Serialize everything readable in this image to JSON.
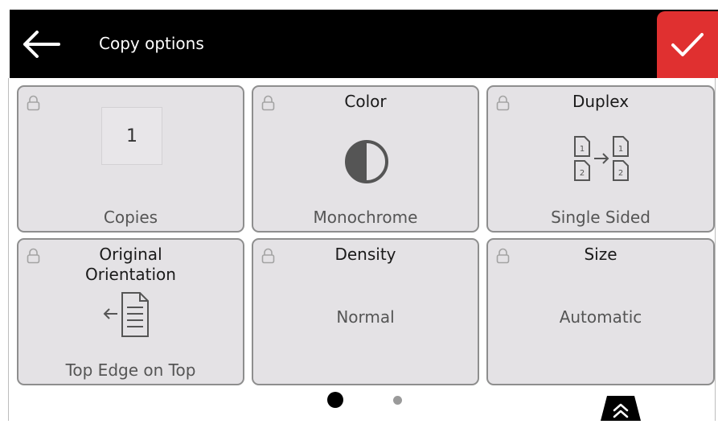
{
  "header": {
    "title": "Copy options",
    "back_icon": "arrow-left-icon",
    "confirm_icon": "checkmark-icon",
    "accent_color": "#e03030"
  },
  "tiles": {
    "copies": {
      "value": "1",
      "label": "Copies"
    },
    "color": {
      "title": "Color",
      "value": "Monochrome",
      "icon": "half-circle-icon"
    },
    "duplex": {
      "title": "Duplex",
      "value": "Single Sided",
      "icon": "duplex-pages-icon",
      "page_numbers": [
        "1",
        "2",
        "1",
        "2"
      ]
    },
    "orientation": {
      "title_line1": "Original",
      "title_line2": "Orientation",
      "value": "Top Edge on Top",
      "icon": "document-arrow-icon"
    },
    "density": {
      "title": "Density",
      "value": "Normal"
    },
    "size": {
      "title": "Size",
      "value": "Automatic"
    }
  },
  "pagination": {
    "current_page": 1,
    "total_pages": 2
  },
  "expand_icon": "double-chevron-up-icon"
}
